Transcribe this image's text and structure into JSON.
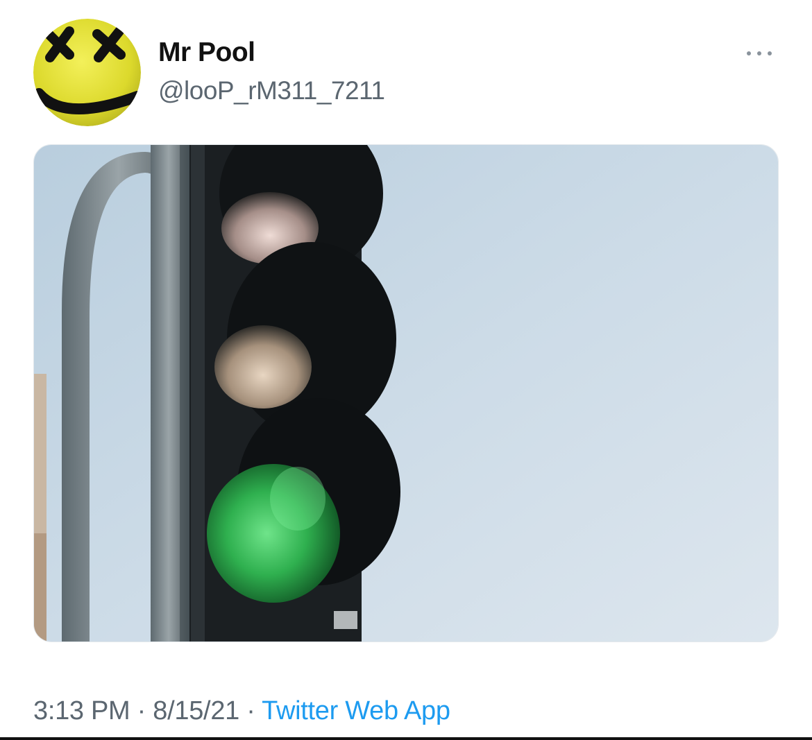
{
  "tweet": {
    "author": {
      "display_name": "Mr Pool",
      "handle": "@looP_rM311_7211",
      "avatar_icon": "yellow-smiley-x-eyes-icon"
    },
    "more_icon": "ellipsis-icon",
    "media": {
      "subject": "green traffic light"
    },
    "meta": {
      "time": "3:13 PM",
      "separator": " · ",
      "date": "8/15/21",
      "source": "Twitter Web App"
    }
  },
  "colors": {
    "link": "#1d9bf0",
    "secondary_text": "#5b6670",
    "avatar_yellow": "#e8e534",
    "green_light": "#3fbf5c"
  }
}
